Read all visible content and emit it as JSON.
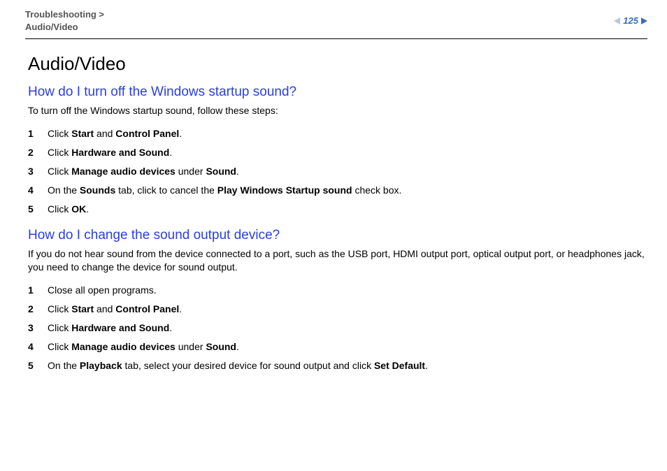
{
  "header": {
    "breadcrumb_line1": "Troubleshooting >",
    "breadcrumb_line2": "Audio/Video",
    "page_number": "125"
  },
  "title": "Audio/Video",
  "section1": {
    "question": "How do I turn off the Windows startup sound?",
    "intro": "To turn off the Windows startup sound, follow these steps:",
    "steps": [
      {
        "num": "1",
        "pre": "Click ",
        "b1": "Start",
        "mid1": " and ",
        "b2": "Control Panel",
        "post": "."
      },
      {
        "num": "2",
        "pre": "Click ",
        "b1": "Hardware and Sound",
        "post": "."
      },
      {
        "num": "3",
        "pre": "Click ",
        "b1": "Manage audio devices",
        "mid1": " under ",
        "b2": "Sound",
        "post": "."
      },
      {
        "num": "4",
        "pre": "On the ",
        "b1": "Sounds",
        "mid1": " tab, click to cancel the ",
        "b2": "Play Windows Startup sound",
        "post": " check box."
      },
      {
        "num": "5",
        "pre": "Click ",
        "b1": "OK",
        "post": "."
      }
    ]
  },
  "section2": {
    "question": "How do I change the sound output device?",
    "intro": "If you do not hear sound from the device connected to a port, such as the USB port, HDMI output port, optical output port, or headphones jack, you need to change the device for sound output.",
    "steps": [
      {
        "num": "1",
        "pre": "Close all open programs."
      },
      {
        "num": "2",
        "pre": "Click ",
        "b1": "Start",
        "mid1": " and ",
        "b2": "Control Panel",
        "post": "."
      },
      {
        "num": "3",
        "pre": "Click ",
        "b1": "Hardware and Sound",
        "post": "."
      },
      {
        "num": "4",
        "pre": "Click ",
        "b1": "Manage audio devices",
        "mid1": " under ",
        "b2": "Sound",
        "post": "."
      },
      {
        "num": "5",
        "pre": "On the ",
        "b1": "Playback",
        "mid1": " tab, select your desired device for sound output and click ",
        "b2": "Set Default",
        "post": "."
      }
    ]
  }
}
